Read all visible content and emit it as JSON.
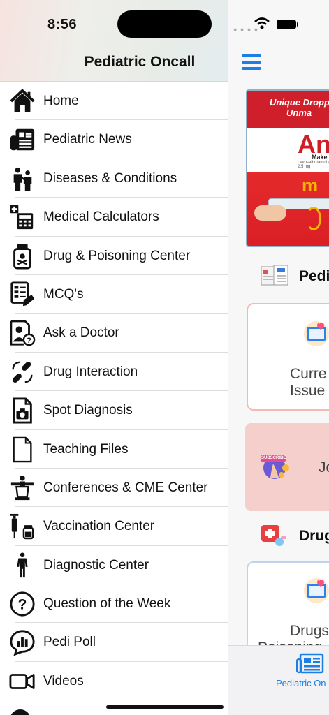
{
  "status_bar": {
    "time": "8:56"
  },
  "drawer": {
    "title": "Pediatric Oncall",
    "items": [
      {
        "label": "Home",
        "icon": "home-icon"
      },
      {
        "label": "Pediatric News",
        "icon": "newspaper-icon"
      },
      {
        "label": "Diseases & Conditions",
        "icon": "doctor-patient-icon"
      },
      {
        "label": "Medical Calculators",
        "icon": "calculator-icon"
      },
      {
        "label": "Drug & Poisoning Center",
        "icon": "poison-bottle-icon"
      },
      {
        "label": "MCQ's",
        "icon": "quiz-document-icon"
      },
      {
        "label": "Ask a Doctor",
        "icon": "ask-doctor-icon"
      },
      {
        "label": "Drug Interaction",
        "icon": "pills-cycle-icon"
      },
      {
        "label": "Spot Diagnosis",
        "icon": "camera-file-icon"
      },
      {
        "label": "Teaching Files",
        "icon": "file-icon"
      },
      {
        "label": "Conferences & CME Center",
        "icon": "podium-icon"
      },
      {
        "label": "Vaccination Center",
        "icon": "syringe-vial-icon"
      },
      {
        "label": "Diagnostic Center",
        "icon": "human-body-icon"
      },
      {
        "label": "Question of the Week",
        "icon": "question-circle-icon"
      },
      {
        "label": "Pedi Poll",
        "icon": "poll-bubble-icon"
      },
      {
        "label": "Videos",
        "icon": "video-camera-icon"
      }
    ]
  },
  "main": {
    "banner": {
      "headline_1": "Unique Dropp",
      "headline_2": "Unma",
      "brand": "An",
      "brand_sub": "Levosalbutamol & 2.5 mg",
      "tagline": "Make"
    },
    "sections": {
      "news_title": "Pedi",
      "drug_title": "Drug"
    },
    "cards": {
      "card1_line1": "Curre",
      "card1_line2": "Issue",
      "card2_label": "Jo",
      "card2_badge": "SUBSCRIBE",
      "card3_line1": "Drugs",
      "card3_line2": "Poisoning"
    },
    "tabbar": {
      "active_label": "Pediatric On"
    },
    "colors": {
      "accent": "#1b7fe6",
      "banner_red": "#cf1f2a",
      "card_pink": "#f4cfcc"
    }
  }
}
